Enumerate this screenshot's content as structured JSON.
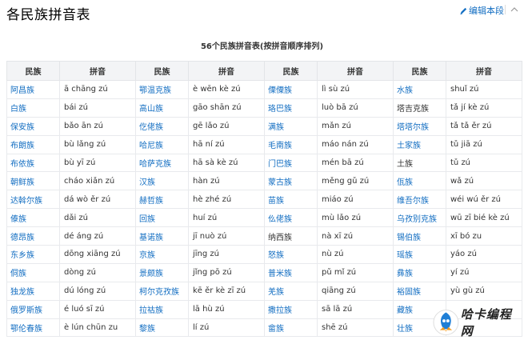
{
  "header": {
    "title": "各民族拼音表",
    "edit_label": "编辑本段"
  },
  "caption": "56个民族拼音表(按拼音顺序排列)",
  "columns": [
    "民族",
    "拼音",
    "民族",
    "拼音",
    "民族",
    "拼音",
    "民族",
    "拼音"
  ],
  "rows": [
    [
      [
        "阿昌族",
        "ā chāng zú",
        true
      ],
      [
        "鄂温克族",
        "è wēn kè zú",
        true
      ],
      [
        "傈僳族",
        "lì sù zú",
        true
      ],
      [
        "水族",
        "shuǐ zú",
        true
      ]
    ],
    [
      [
        "白族",
        "bái zú",
        true
      ],
      [
        "高山族",
        "gāo shān zú",
        true
      ],
      [
        "珞巴族",
        "luò bā zú",
        true
      ],
      [
        "塔吉克族",
        "tǎ jí kè zú",
        false
      ]
    ],
    [
      [
        "保安族",
        "bǎo ān zú",
        true
      ],
      [
        "仡佬族",
        "gē lǎo zú",
        true
      ],
      [
        "满族",
        "mǎn zú",
        true
      ],
      [
        "塔塔尔族",
        "tǎ tǎ ěr zú",
        true
      ]
    ],
    [
      [
        "布朗族",
        "bù lǎng zú",
        true
      ],
      [
        "哈尼族",
        "hā ní zú",
        true
      ],
      [
        "毛南族",
        "máo nán zú",
        true
      ],
      [
        "土家族",
        "tǔ jiā zú",
        true
      ]
    ],
    [
      [
        "布依族",
        "bù yī zú",
        true
      ],
      [
        "哈萨克族",
        "hā sà kè zú",
        true
      ],
      [
        "门巴族",
        "mén bā zú",
        true
      ],
      [
        "土族",
        "tǔ zú",
        false
      ]
    ],
    [
      [
        "朝鲜族",
        "cháo xiǎn zú",
        true
      ],
      [
        "汉族",
        "hàn zú",
        true
      ],
      [
        "蒙古族",
        "měng gǔ zú",
        true
      ],
      [
        "佤族",
        "wǎ zú",
        true
      ]
    ],
    [
      [
        "达斡尔族",
        "dá wò ěr zú",
        true
      ],
      [
        "赫哲族",
        "hè zhé zú",
        true
      ],
      [
        "苗族",
        "miáo zú",
        true
      ],
      [
        "维吾尔族",
        "wéi wú ěr zú",
        true
      ]
    ],
    [
      [
        "傣族",
        "dǎi zú",
        true
      ],
      [
        "回族",
        "huí zú",
        true
      ],
      [
        "仫佬族",
        "mù lǎo zú",
        true
      ],
      [
        "乌孜别克族",
        "wū zī bié kè zú",
        true
      ]
    ],
    [
      [
        "德昂族",
        "dé áng zú",
        true
      ],
      [
        "基诺族",
        "jī nuò zú",
        true
      ],
      [
        "纳西族",
        "nà xī zú",
        false
      ],
      [
        "锡伯族",
        "xī bó zu",
        true
      ]
    ],
    [
      [
        "东乡族",
        "dōng xiāng zú",
        true
      ],
      [
        "京族",
        "jīng zú",
        true
      ],
      [
        "怒族",
        "nù zú",
        true
      ],
      [
        "瑶族",
        "yáo zú",
        true
      ]
    ],
    [
      [
        "侗族",
        "dòng zú",
        true
      ],
      [
        "景颇族",
        "jǐng pō zú",
        true
      ],
      [
        "普米族",
        "pǔ mǐ zú",
        true
      ],
      [
        "彝族",
        "yí zú",
        true
      ]
    ],
    [
      [
        "独龙族",
        "dú lóng zú",
        true
      ],
      [
        "柯尔克孜族",
        "kē ěr kè zī zú",
        true
      ],
      [
        "羌族",
        "qiāng zú",
        true
      ],
      [
        "裕固族",
        "yù gù zú",
        true
      ]
    ],
    [
      [
        "俄罗斯族",
        "é luó sī zú",
        true
      ],
      [
        "拉祜族",
        "lā hù zú",
        true
      ],
      [
        "撒拉族",
        "sā lā zú",
        true
      ],
      [
        "藏族",
        "",
        true
      ]
    ],
    [
      [
        "鄂伦春族",
        "è lún chūn zu",
        true
      ],
      [
        "黎族",
        "lí zú",
        true
      ],
      [
        "畲族",
        "shē zú",
        true
      ],
      [
        "壮族",
        "",
        true
      ]
    ]
  ],
  "watermark": {
    "text": "哈卡编程网"
  }
}
